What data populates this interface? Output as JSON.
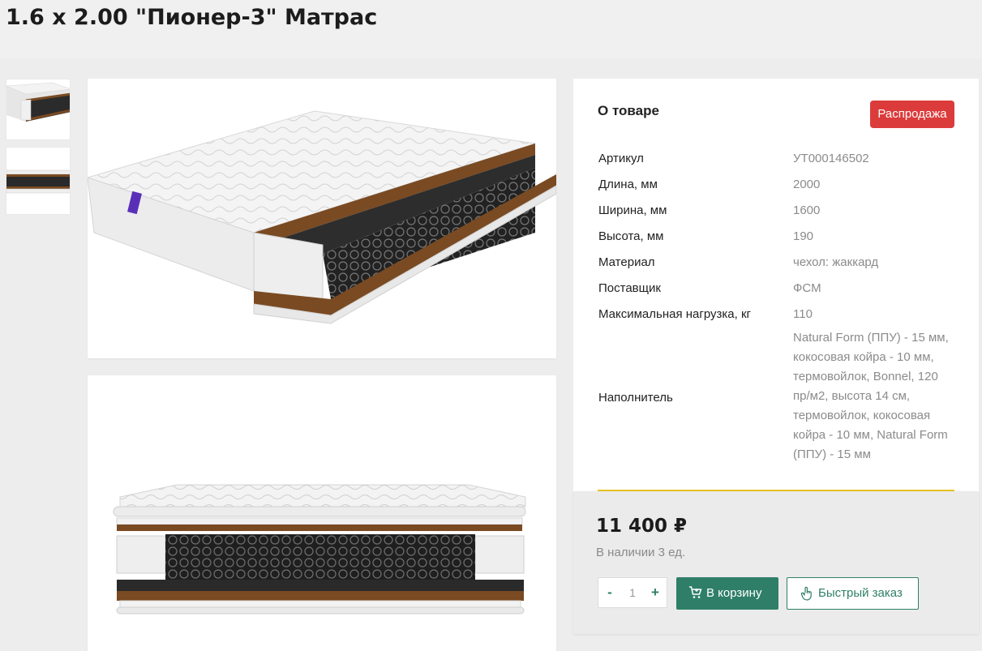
{
  "page": {
    "title": "1.6 x 2.00 \"Пионер-3\" Матрас"
  },
  "gallery": {
    "thumbnails": [
      {
        "icon": "mattress-cutaway-thumbnail"
      },
      {
        "icon": "mattress-layers-thumbnail"
      }
    ],
    "images": [
      {
        "icon": "mattress-cutaway-image"
      },
      {
        "icon": "mattress-layers-image"
      }
    ]
  },
  "info": {
    "title": "О товаре",
    "badge": "Распродажа",
    "badge_color": "#dc3b3b",
    "specs": [
      {
        "label": "Артикул",
        "value": "УТ000146502"
      },
      {
        "label": "Длина, мм",
        "value": "2000"
      },
      {
        "label": "Ширина, мм",
        "value": "1600"
      },
      {
        "label": "Высота, мм",
        "value": "190"
      },
      {
        "label": "Материал",
        "value": "чехол: жаккард"
      },
      {
        "label": "Поставщик",
        "value": "ФСМ"
      },
      {
        "label": "Максимальная нагрузка, кг",
        "value": "110"
      },
      {
        "label": "Наполнитель",
        "value": "Natural Form (ППУ) - 15 мм, кокосовая койра - 10 мм, термовойлок, Bonnel, 120 пр/м2, высота 14 см, термовойлок, кокосовая койра - 10 мм, Natural Form (ППУ) - 15 мм"
      }
    ]
  },
  "purchase": {
    "price": "11 400 ₽",
    "stock": "В наличии 3 ед.",
    "qty_minus": "-",
    "qty_value": "1",
    "qty_plus": "+",
    "cart_label": "В корзину",
    "cart_icon": "cart-icon",
    "quick_label": "Быстрый заказ",
    "quick_icon": "tap-hand-icon",
    "accent_color": "#2f7f68",
    "divider_color": "#e7c322"
  }
}
